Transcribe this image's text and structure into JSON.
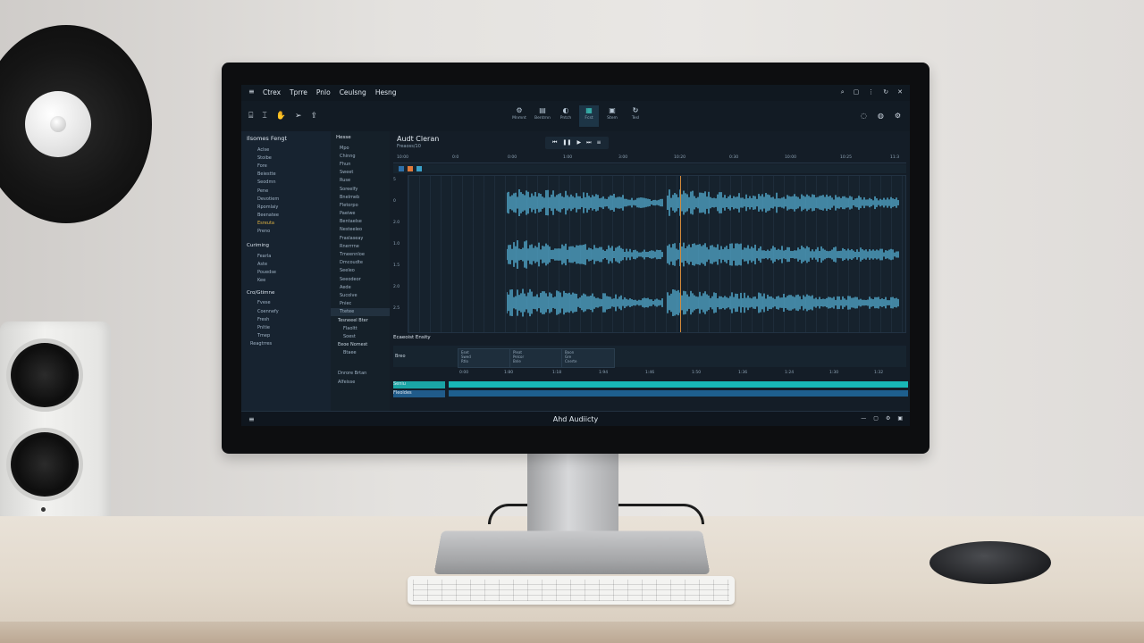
{
  "app": {
    "menu": [
      "Ctrex",
      "Tprre",
      "Pnlo",
      "Ceulsng",
      "Hesng"
    ],
    "window_title": "Ahd Audiicty"
  },
  "toolbar": {
    "left_icons": [
      "open-icon",
      "cut-icon",
      "hand-icon",
      "send-icon",
      "share-icon"
    ],
    "center_buttons": [
      {
        "icon": "⚙",
        "label": "Mnmnt"
      },
      {
        "icon": "▤",
        "label": "Bentrnn"
      },
      {
        "icon": "◐",
        "label": "Pntch"
      },
      {
        "icon": "▦",
        "label": "Fcst"
      },
      {
        "icon": "▣",
        "label": "Stem"
      },
      {
        "icon": "↻",
        "label": "Tesl"
      }
    ],
    "right_icons": [
      "help-icon",
      "sync-icon",
      "settings-icon"
    ]
  },
  "sidebar": {
    "title": "Ilsomes Fengt",
    "items": [
      "Aclse",
      "Stoibe",
      "Fore",
      "Beiestte",
      "Seodmn",
      "Pene",
      "Devotiem",
      "Rpomlaiy",
      "Beenatee",
      "Esreuta",
      "Preno"
    ],
    "section2_title": "Curiming",
    "section2_items": [
      "Fearla",
      "Aste",
      "Pouedse",
      "Kee"
    ],
    "section3_title": "Cro/Gtimne",
    "section3_items": [
      "Fvese",
      "Coennefy",
      "Fresh",
      "Pnltie",
      "Tmep"
    ],
    "footer_item": "Reagtrres"
  },
  "browser": {
    "title": "Hesse",
    "items": [
      "Mpo",
      "Chinng",
      "Fhun",
      "Sweet",
      "Ruse",
      "Soreelfy",
      "Bnelmeb",
      "Fletorpo",
      "Paeiwe",
      "Bentaelse",
      "Nesteeleo",
      "Fraslaseay",
      "Rnerrrne",
      "Tmeennloe",
      "Dmcoudte",
      "Seeleo",
      "Seeodeor",
      "Aede",
      "Sucolve",
      "Pniec",
      "Ttetee"
    ],
    "group1_title": "Tesneeel Bter",
    "group1_items": [
      "Flaoltt",
      "Soest"
    ],
    "group2_title": "Eeoe Nomest",
    "group2_items": [
      "Btaee"
    ],
    "footer_items": [
      "Dnrore Brtan",
      "Alfeisse"
    ]
  },
  "project": {
    "title": "Audt Cleran",
    "subtitle": "Freaoss/10",
    "transport": [
      "⏮",
      "❚❚",
      "▶",
      "⏭",
      "≡"
    ],
    "ruler": [
      "10:00",
      "0:0",
      "0:00",
      "1:00",
      "3:00",
      "10:20",
      "0:30",
      "10:00",
      "10:25",
      "11:3",
      "0:40"
    ],
    "yaxis": [
      "5",
      "0",
      "2.0",
      "1.0",
      "1.5",
      "2.0",
      "2.5",
      "0.0"
    ]
  },
  "lower_panel": {
    "title": "Ecaeoist Ensity",
    "label_a": "Breo",
    "fx": [
      [
        "Eset",
        "Swed",
        "Rtlo"
      ],
      [
        "Pleat",
        "Pelcor",
        "Bnle"
      ],
      [
        "Boon",
        "Gre",
        "Cnerte"
      ]
    ],
    "timeline": [
      "0:00",
      "1:80",
      "1:18",
      "1:94",
      "1:46",
      "1:50",
      "1:36",
      "1:24",
      "1:30",
      "1:32"
    ],
    "lanes": [
      "Seniu",
      "Fleoldes"
    ]
  },
  "status": {
    "right_icons": [
      "minimize-icon",
      "maximize-icon",
      "settings-icon",
      "close-icon"
    ]
  },
  "colors": {
    "accent": "#3fd3c7",
    "waveform": "#55b0d4",
    "playhead": "#d48a3a",
    "panel_bg": "#141d27"
  }
}
